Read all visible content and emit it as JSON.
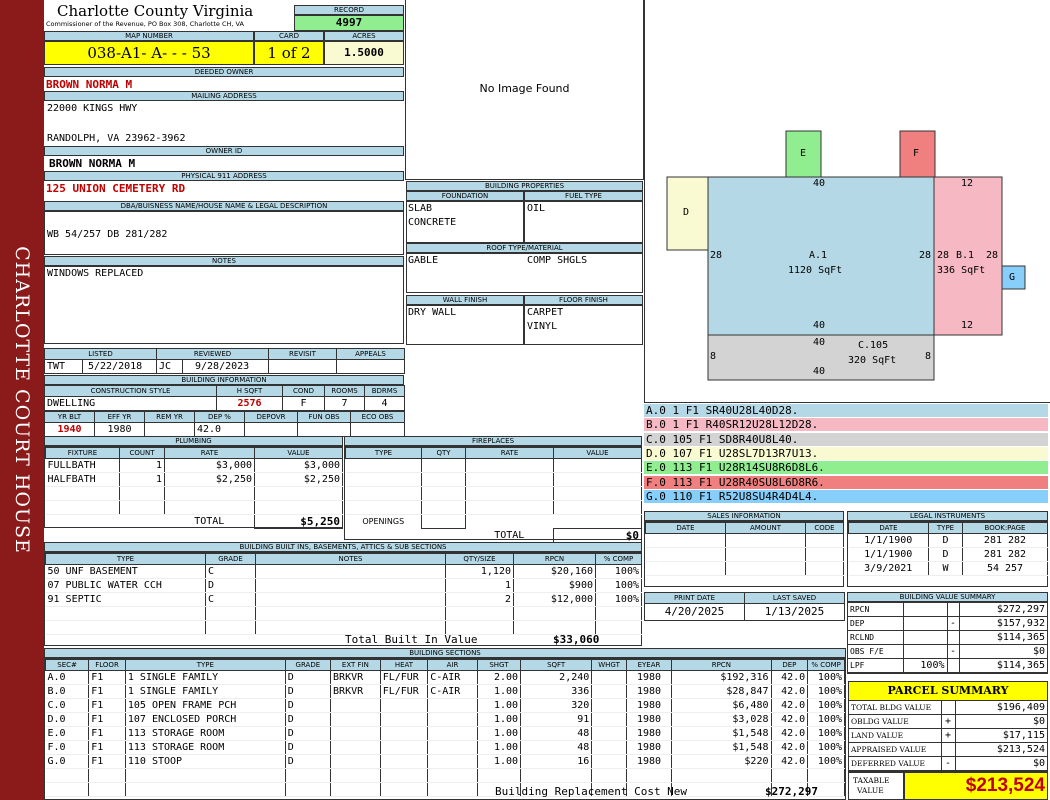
{
  "sidebar": {
    "title": "CHARLOTTE COURT HOUSE"
  },
  "header": {
    "county": "Charlotte County Virginia",
    "subtitle": "Commissioner of the Revenue, PO Box 308, Charlotte CH, VA",
    "record_label": "RECORD",
    "record": "4997"
  },
  "parcel": {
    "map_label": "MAP NUMBER",
    "map_number": "038-A1- A-  -  - 53",
    "card_label": "CARD",
    "card": "1 of 2",
    "acres_label": "ACRES",
    "acres": "1.5000"
  },
  "owner": {
    "deeded_label": "DEEDED OWNER",
    "deeded": "BROWN NORMA M",
    "mailing_label": "MAILING ADDRESS",
    "mail1": "22000 KINGS HWY",
    "mail2": "RANDOLPH, VA 23962-3962",
    "ownerid_label": "OWNER ID",
    "ownerid": "BROWN NORMA M",
    "addr_label": "PHYSICAL 911 ADDRESS",
    "addr": "125 UNION CEMETERY RD",
    "dba_label": "DBA/BUISNESS NAME/HOUSE NAME & LEGAL DESCRIPTION",
    "dba": "WB 54/257 DB 281/282",
    "notes_label": "NOTES",
    "notes": "WINDOWS REPLACED"
  },
  "photo": {
    "text": "No Image Found"
  },
  "props": {
    "title": "BUILDING PROPERTIES",
    "found_label": "FOUNDATION",
    "fuel_label": "FUEL TYPE",
    "found1": "SLAB",
    "found2": "CONCRETE",
    "fuel": "OIL",
    "roof_label": "ROOF TYPE/MATERIAL",
    "roof1": "GABLE",
    "roof2": "COMP SHGLS",
    "wall_label": "WALL FINISH",
    "floor_label": "FLOOR FINISH",
    "wall": "DRY WALL",
    "floor1": "CARPET",
    "floor2": "VINYL"
  },
  "review": {
    "listed_label": "LISTED",
    "reviewed_label": "REVIEWED",
    "revisit_label": "REVISIT",
    "appeals_label": "APPEALS",
    "listed_by": "TWT",
    "listed_date": "5/22/2018",
    "rev_by": "JC",
    "rev_date": "9/28/2023"
  },
  "bldginfo": {
    "title": "BUILDING INFORMATION",
    "style_label": "CONSTRUCTION STYLE",
    "hsqft_label": "H SQFT",
    "cond_label": "COND",
    "rooms_label": "ROOMS",
    "bdrms_label": "BDRMS",
    "style": "DWELLING",
    "hsqft": "2576",
    "cond": "F",
    "rooms": "7",
    "bdrms": "4",
    "yrblt_label": "YR BLT",
    "effyr_label": "EFF YR",
    "remyr_label": "REM YR",
    "dep_label": "DEP %",
    "depovr_label": "DEPOVR",
    "funobs_label": "FUN OBS",
    "ecoobs_label": "ECO OBS",
    "yrblt": "1940",
    "effyr": "1980",
    "dep": "42.0"
  },
  "plumbing": {
    "title": "PLUMBING",
    "headers": [
      "FIXTURE",
      "COUNT",
      "RATE",
      "VALUE"
    ],
    "rows": [
      [
        "FULLBATH",
        "1",
        "$3,000",
        "$3,000"
      ],
      [
        "HALFBATH",
        "1",
        "$2,250",
        "$2,250"
      ]
    ],
    "total_label": "TOTAL",
    "total": "$5,250"
  },
  "fireplaces": {
    "title": "FIREPLACES",
    "headers": [
      "TYPE",
      "QTY",
      "RATE",
      "VALUE"
    ],
    "openings": "OPENINGS",
    "total_label": "TOTAL",
    "total": "$0"
  },
  "builtins": {
    "title": "BUILDING BUILT INS, BASEMENTS, ATTICS & SUB SECTIONS",
    "headers": [
      "TYPE",
      "GRADE",
      "NOTES",
      "QTY/SIZE",
      "RPCN",
      "% COMP"
    ],
    "rows": [
      [
        "50 UNF BASEMENT",
        "C",
        "",
        "1,120",
        "$20,160",
        "100%"
      ],
      [
        "07 PUBLIC WATER CCH",
        "D",
        "",
        "1",
        "$900",
        "100%"
      ],
      [
        "91 SEPTIC",
        "C",
        "",
        "2",
        "$12,000",
        "100%"
      ]
    ],
    "total_label": "Total Built In Value",
    "total": "$33,060"
  },
  "sections": {
    "title": "BUILDING SECTIONS",
    "headers": [
      "SEC#",
      "FLOOR",
      "TYPE",
      "GRADE",
      "EXT FIN",
      "HEAT",
      "AIR",
      "SHGT",
      "SQFT",
      "WHGT",
      "EYEAR",
      "RPCN",
      "DEP",
      "% COMP"
    ],
    "rows": [
      [
        "A.0",
        "F1",
        "1 SINGLE FAMILY",
        "D",
        "BRKVR",
        "FL/FUR",
        "C-AIR",
        "2.00",
        "2,240",
        "",
        "1980",
        "$192,316",
        "42.0",
        "100%"
      ],
      [
        "B.0",
        "F1",
        "1 SINGLE FAMILY",
        "D",
        "BRKVR",
        "FL/FUR",
        "C-AIR",
        "1.00",
        "336",
        "",
        "1980",
        "$28,847",
        "42.0",
        "100%"
      ],
      [
        "C.0",
        "F1",
        "105 OPEN FRAME PCH",
        "D",
        "",
        "",
        "",
        "1.00",
        "320",
        "",
        "1980",
        "$6,480",
        "42.0",
        "100%"
      ],
      [
        "D.0",
        "F1",
        "107 ENCLOSED PORCH",
        "D",
        "",
        "",
        "",
        "1.00",
        "91",
        "",
        "1980",
        "$3,028",
        "42.0",
        "100%"
      ],
      [
        "E.0",
        "F1",
        "113 STORAGE ROOM",
        "D",
        "",
        "",
        "",
        "1.00",
        "48",
        "",
        "1980",
        "$1,548",
        "42.0",
        "100%"
      ],
      [
        "F.0",
        "F1",
        "113 STORAGE ROOM",
        "D",
        "",
        "",
        "",
        "1.00",
        "48",
        "",
        "1980",
        "$1,548",
        "42.0",
        "100%"
      ],
      [
        "G.0",
        "F1",
        "110 STOOP",
        "D",
        "",
        "",
        "",
        "1.00",
        "16",
        "",
        "1980",
        "$220",
        "42.0",
        "100%"
      ]
    ],
    "total_label": "Building Replacement Cost New",
    "total": "$272,297"
  },
  "sketch": {
    "A_label": "A.1",
    "A_area": "1120 SqFt",
    "B_label": "B.1",
    "B_area": "336 SqFt",
    "C_label": "C.105",
    "C_area": "320 SqFt",
    "D": "D",
    "E": "E",
    "F": "F",
    "G": "G",
    "d40a": "40",
    "d40b": "40",
    "d40c": "40",
    "d40d": "40",
    "d28a": "28",
    "d28b": "28",
    "d28c": "28",
    "d28d": "28",
    "d12a": "12",
    "d12b": "12",
    "d8a": "8",
    "d8b": "8"
  },
  "segments": [
    {
      "text": "A.0  1     F1   SR40U28L40D28.",
      "color": "#b5d8e6"
    },
    {
      "text": "B.0  1     F1   R40SR12U28L12D28.",
      "color": "#f6b8c3"
    },
    {
      "text": "C.0  105   F1   SD8R40U8L40.",
      "color": "#d3d3d3"
    },
    {
      "text": "D.0  107   F1   U28SL7D13R7U13.",
      "color": "#fafad2"
    },
    {
      "text": "E.0  113   F1   U28R14SU8R6D8L6.",
      "color": "#90ee90"
    },
    {
      "text": "F.0  113   F1   U28R40SU8L6D8R6.",
      "color": "#f08080"
    },
    {
      "text": "G.0  110   F1   R52U8SU4R4D4L4.",
      "color": "#87cefa"
    }
  ],
  "sales": {
    "title": "SALES INFORMATION",
    "date_label": "DATE",
    "amount_label": "AMOUNT",
    "code_label": "CODE"
  },
  "legal": {
    "title": "LEGAL INSTRUMENTS",
    "headers": [
      "DATE",
      "TYPE",
      "BOOK:PAGE"
    ],
    "rows": [
      [
        "1/1/1900",
        "D",
        "281 282"
      ],
      [
        "1/1/1900",
        "D",
        "281 282"
      ],
      [
        "3/9/2021",
        "W",
        "54 257"
      ]
    ]
  },
  "print": {
    "print_label": "PRINT DATE",
    "saved_label": "LAST SAVED",
    "print_date": "4/20/2025",
    "saved": "1/13/2025"
  },
  "bvs": {
    "title": "BUILDING VALUE SUMMARY",
    "rows": [
      [
        "RPCN",
        "",
        "",
        "$272,297"
      ],
      [
        "DEP",
        "",
        "-",
        "$157,932"
      ],
      [
        "RCLND",
        "",
        "",
        "$114,365"
      ],
      [
        "OBS F/E",
        "",
        "-",
        "$0"
      ],
      [
        "LPF",
        "100%",
        "",
        "$114,365"
      ]
    ]
  },
  "summary": {
    "title": "PARCEL SUMMARY",
    "rows": [
      [
        "TOTAL BLDG VALUE",
        "",
        "$196,409"
      ],
      [
        "OBLDG VALUE",
        "+",
        "$0"
      ],
      [
        "LAND VALUE",
        "+",
        "$17,115"
      ],
      [
        "APPRAISED VALUE",
        "",
        "$213,524"
      ],
      [
        "DEFERRED VALUE",
        "-",
        "$0"
      ]
    ],
    "taxable_label1": "TAXABLE",
    "taxable_label2": "VALUE",
    "taxable": "$213,524"
  }
}
